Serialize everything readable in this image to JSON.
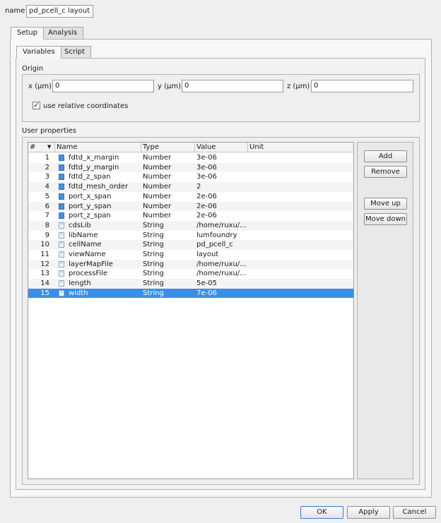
{
  "name_label": "name",
  "name_value": "pd_pcell_c layout",
  "outer_tabs": [
    {
      "label": "Setup"
    },
    {
      "label": "Analysis"
    }
  ],
  "inner_tabs": [
    {
      "label": "Variables"
    },
    {
      "label": "Script"
    }
  ],
  "origin": {
    "title": "Origin",
    "x_label": "x (μm)",
    "x_value": "0",
    "y_label": "y (μm)",
    "y_value": "0",
    "z_label": "z (μm)",
    "z_value": "0",
    "relative_label": "use relative coordinates",
    "relative_checked": "✓"
  },
  "user_properties": {
    "title": "User properties",
    "columns": {
      "num": "#",
      "name": "Name",
      "type": "Type",
      "value": "Value",
      "unit": "Unit"
    },
    "rows": [
      {
        "num": "1",
        "name": "fdtd_x_margin",
        "type": "Number",
        "value": "3e-06",
        "icon": "number-icon"
      },
      {
        "num": "2",
        "name": "fdtd_y_margin",
        "type": "Number",
        "value": "3e-06",
        "icon": "number-icon"
      },
      {
        "num": "3",
        "name": "fdtd_z_span",
        "type": "Number",
        "value": "3e-06",
        "icon": "number-icon"
      },
      {
        "num": "4",
        "name": "fdtd_mesh_order",
        "type": "Number",
        "value": "2",
        "icon": "number-icon"
      },
      {
        "num": "5",
        "name": "port_x_span",
        "type": "Number",
        "value": "2e-06",
        "icon": "number-icon"
      },
      {
        "num": "6",
        "name": "port_y_span",
        "type": "Number",
        "value": "2e-06",
        "icon": "number-icon"
      },
      {
        "num": "7",
        "name": "port_z_span",
        "type": "Number",
        "value": "2e-06",
        "icon": "number-icon"
      },
      {
        "num": "8",
        "name": "cdsLib",
        "type": "String",
        "value": "/home/ruxu/...",
        "icon": "string-icon"
      },
      {
        "num": "9",
        "name": "libName",
        "type": "String",
        "value": "lumfoundry",
        "icon": "string-icon"
      },
      {
        "num": "10",
        "name": "cellName",
        "type": "String",
        "value": "pd_pcell_c",
        "icon": "string-icon"
      },
      {
        "num": "11",
        "name": "viewName",
        "type": "String",
        "value": "layout",
        "icon": "string-icon"
      },
      {
        "num": "12",
        "name": "layerMapFile",
        "type": "String",
        "value": "/home/ruxu/...",
        "icon": "string-icon"
      },
      {
        "num": "13",
        "name": "processFile",
        "type": "String",
        "value": "/home/ruxu/...",
        "icon": "string-icon"
      },
      {
        "num": "14",
        "name": "length",
        "type": "String",
        "value": "5e-05",
        "icon": "string-icon"
      },
      {
        "num": "15",
        "name": "width",
        "type": "String",
        "value": "7e-06",
        "icon": "string-icon"
      }
    ],
    "selected_row": "15",
    "buttons": {
      "add": "Add",
      "remove": "Remove",
      "move_up": "Move up",
      "move_down": "Move down"
    }
  },
  "footer": {
    "ok": "OK",
    "apply": "Apply",
    "cancel": "Cancel"
  },
  "colors": {
    "selection": "#3a8ee6",
    "default_button_border": "#3b7bd4"
  }
}
